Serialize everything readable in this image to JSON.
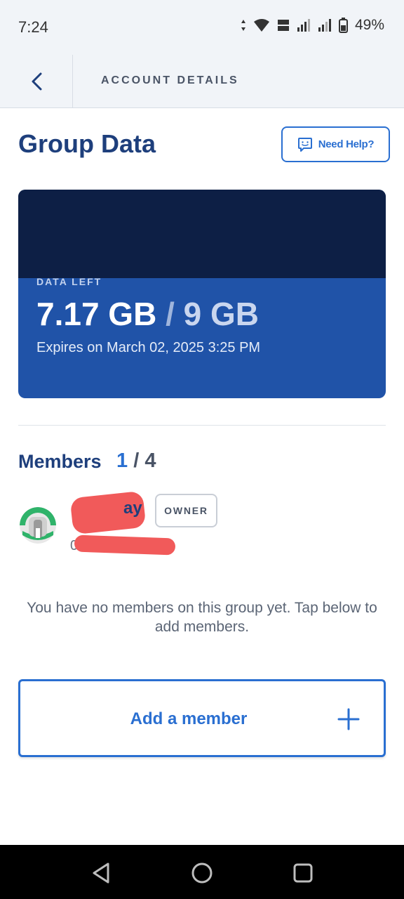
{
  "status_bar": {
    "time": "7:24",
    "battery": "49%"
  },
  "header": {
    "title": "ACCOUNT DETAILS"
  },
  "page": {
    "title": "Group Data",
    "help_label": "Need Help?"
  },
  "data_card": {
    "label": "DATA LEFT",
    "remaining": "7.17 GB",
    "separator": "/",
    "total": "9 GB",
    "expiry": "Expires on March 02, 2025 3:25 PM",
    "colors": {
      "top": "#0d1f45",
      "bottom": "#2053a8"
    }
  },
  "members": {
    "title": "Members",
    "used": "1",
    "separator": "/",
    "total": "4",
    "list": [
      {
        "name_suffix": "ay",
        "phone_prefix": "0",
        "badge": "OWNER"
      }
    ],
    "empty_message": "You have no members on this group yet. Tap below to add members.",
    "add_label": "Add a member"
  },
  "colors": {
    "accent": "#2a6fd1",
    "title": "#1e3f7c"
  }
}
